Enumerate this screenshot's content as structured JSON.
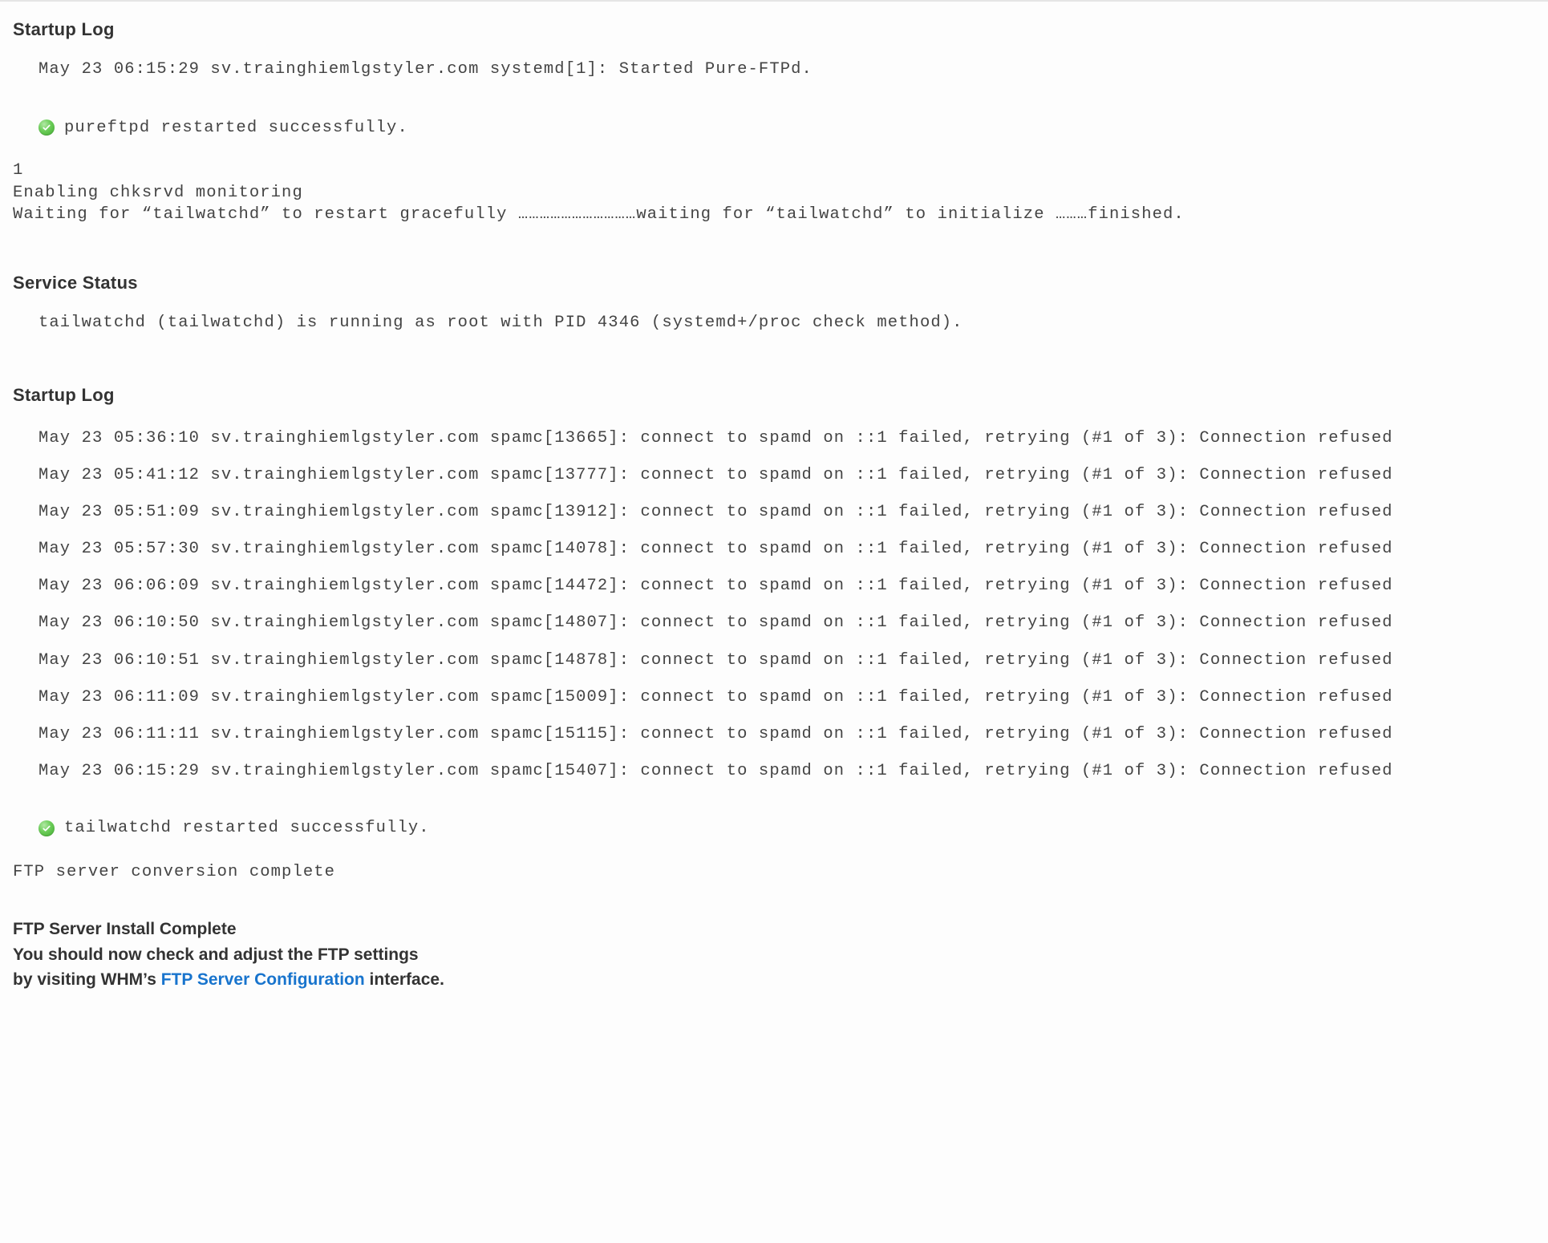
{
  "section1": {
    "heading": "Startup Log",
    "log_line": "May 23 06:15:29 sv.trainghiemlgstyler.com systemd[1]: Started Pure-FTPd.",
    "status_text": "pureftpd restarted successfully."
  },
  "mid_block": {
    "line1": "1",
    "line2": "Enabling chksrvd monitoring",
    "line3": "Waiting for “tailwatchd” to restart gracefully ……………………………waiting for “tailwatchd” to initialize ………finished."
  },
  "section2": {
    "heading": "Service Status",
    "log_line": "tailwatchd (tailwatchd) is running as root with PID 4346 (systemd+/proc check method)."
  },
  "section3": {
    "heading": "Startup Log",
    "log_lines": [
      "May 23 05:36:10 sv.trainghiemlgstyler.com spamc[13665]: connect to spamd on ::1 failed, retrying (#1 of 3): Connection refused",
      "May 23 05:41:12 sv.trainghiemlgstyler.com spamc[13777]: connect to spamd on ::1 failed, retrying (#1 of 3): Connection refused",
      "May 23 05:51:09 sv.trainghiemlgstyler.com spamc[13912]: connect to spamd on ::1 failed, retrying (#1 of 3): Connection refused",
      "May 23 05:57:30 sv.trainghiemlgstyler.com spamc[14078]: connect to spamd on ::1 failed, retrying (#1 of 3): Connection refused",
      "May 23 06:06:09 sv.trainghiemlgstyler.com spamc[14472]: connect to spamd on ::1 failed, retrying (#1 of 3): Connection refused",
      "May 23 06:10:50 sv.trainghiemlgstyler.com spamc[14807]: connect to spamd on ::1 failed, retrying (#1 of 3): Connection refused",
      "May 23 06:10:51 sv.trainghiemlgstyler.com spamc[14878]: connect to spamd on ::1 failed, retrying (#1 of 3): Connection refused",
      "May 23 06:11:09 sv.trainghiemlgstyler.com spamc[15009]: connect to spamd on ::1 failed, retrying (#1 of 3): Connection refused",
      "May 23 06:11:11 sv.trainghiemlgstyler.com spamc[15115]: connect to spamd on ::1 failed, retrying (#1 of 3): Connection refused",
      "May 23 06:15:29 sv.trainghiemlgstyler.com spamc[15407]: connect to spamd on ::1 failed, retrying (#1 of 3): Connection refused"
    ],
    "status_text": "tailwatchd restarted successfully."
  },
  "conversion_line": "FTP server conversion complete",
  "footer": {
    "line1": "FTP Server Install Complete",
    "line2": "You should now check and adjust the FTP settings",
    "line3_pre": "by visiting WHM’s ",
    "link_text": "FTP Server Configuration",
    "line3_post": " interface."
  }
}
